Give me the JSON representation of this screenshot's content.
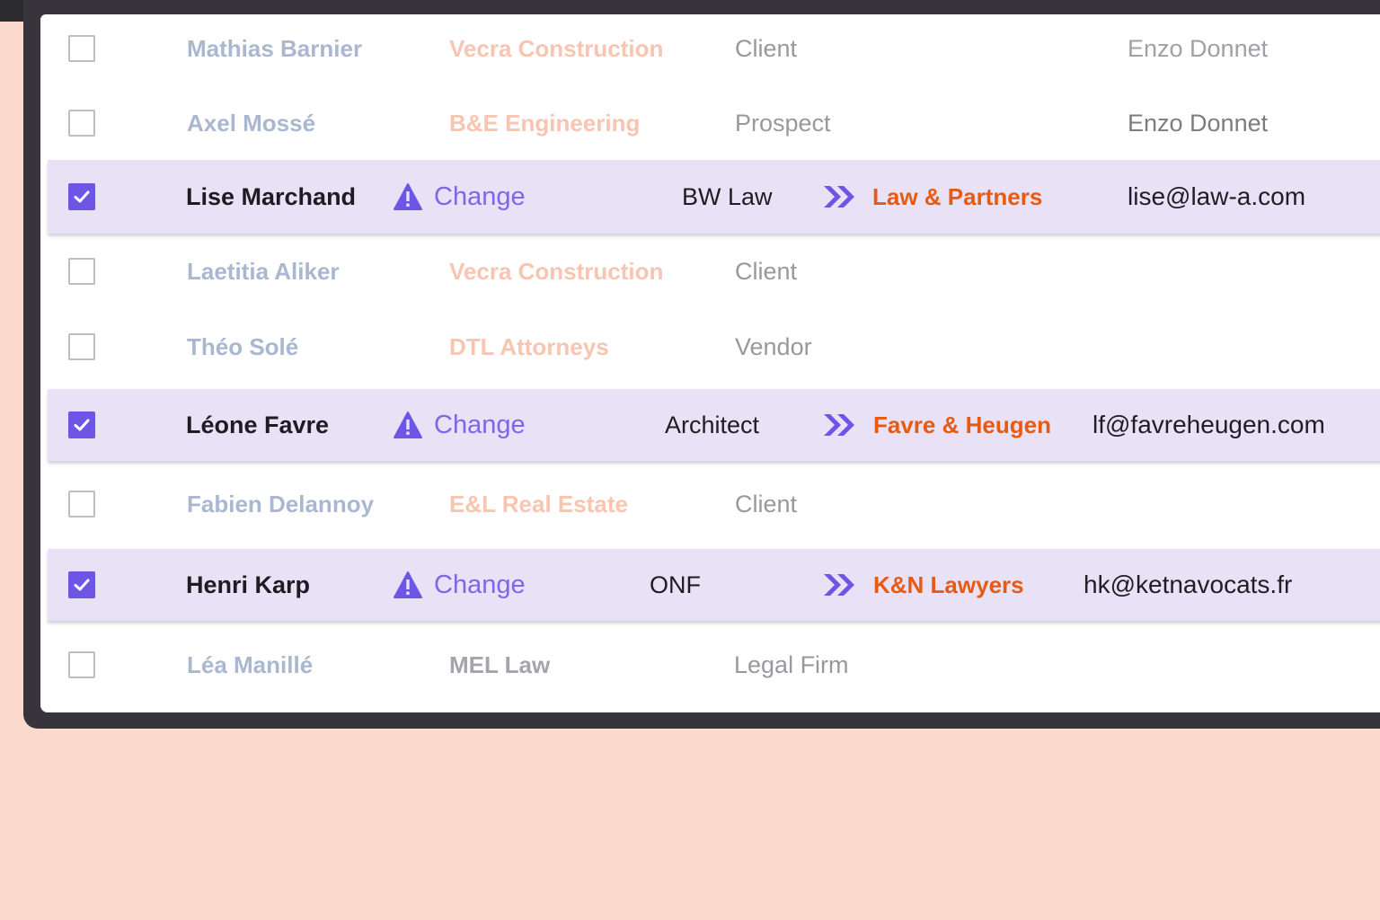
{
  "colors": {
    "background": "#fbd9cc",
    "frame": "#37353b",
    "accent": "#6d55e6",
    "selected_row": "#e9e2f6",
    "new_company": "#e75a12"
  },
  "icons": {
    "warning": "warning-triangle-icon",
    "arrow": "double-chevron-right-icon",
    "check": "checkmark-icon"
  },
  "rows": [
    {
      "selected": false,
      "name": "Mathias Barnier",
      "company": "Vecra Construction",
      "type": "Client",
      "owner": "Enzo Donnet"
    },
    {
      "selected": false,
      "name": "Axel Mossé",
      "company": "B&E Engineering",
      "type": "Prospect",
      "owner": "Enzo Donnet"
    },
    {
      "selected": true,
      "name": "Lise Marchand",
      "change": "Change",
      "old": "BW Law",
      "new": "Law & Partners",
      "email": "lise@law-a.com"
    },
    {
      "selected": false,
      "name": "Laetitia Aliker",
      "company": "Vecra Construction",
      "type": "Client"
    },
    {
      "selected": false,
      "name": "Théo Solé",
      "company": "DTL Attorneys",
      "type": "Vendor"
    },
    {
      "selected": true,
      "name": "Léone Favre",
      "change": "Change",
      "old": "Architect",
      "new": "Favre & Heugen",
      "email": "lf@favreheugen.com"
    },
    {
      "selected": false,
      "name": "Fabien Delannoy",
      "company": "E&L Real Estate",
      "type": "Client"
    },
    {
      "selected": true,
      "name": "Henri Karp",
      "change": "Change",
      "old": "ONF",
      "new": "K&N Lawyers",
      "email": "hk@ketnavocats.fr"
    },
    {
      "selected": false,
      "name": "Léa Manillé",
      "company": "MEL Law",
      "type": "Legal Firm"
    }
  ]
}
